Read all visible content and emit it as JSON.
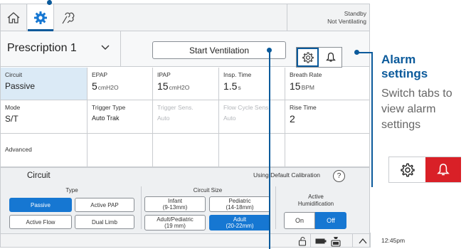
{
  "status": {
    "line1": "Standby",
    "line2": "Not Ventilating"
  },
  "prescription": {
    "name": "Prescription 1",
    "start_label": "Start Ventilation"
  },
  "grid": {
    "circuit": {
      "label": "Circuit",
      "value": "Passive"
    },
    "mode": {
      "label": "Mode",
      "value": "S/T"
    },
    "advanced": {
      "label": "Advanced"
    },
    "epap": {
      "label": "EPAP",
      "value": "5",
      "unit": "cmH2O"
    },
    "ipap": {
      "label": "IPAP",
      "value": "15",
      "unit": "cmH2O"
    },
    "insp_time": {
      "label": "Insp. Time",
      "value": "1.5",
      "unit": "s"
    },
    "breath_rate": {
      "label": "Breath Rate",
      "value": "15",
      "unit": "BPM"
    },
    "trigger_type": {
      "label": "Trigger Type",
      "value": "Auto Trak"
    },
    "trigger_sens": {
      "label": "Trigger Sens.",
      "value": "Auto"
    },
    "flow_cycle": {
      "label": "Flow Cycle Sens.",
      "value": "Auto"
    },
    "rise_time": {
      "label": "Rise Time",
      "value": "2"
    }
  },
  "circuit_panel": {
    "title": "Circuit",
    "calibration": "Using Default Calibration",
    "help": "?",
    "type_label": "Type",
    "types": [
      "Passive",
      "Active PAP",
      "Active Flow",
      "Dual Limb"
    ],
    "size_label": "Circuit Size",
    "sizes": [
      "Infant\n(9-13mm)",
      "Pediatric\n(14-18mm)",
      "Adult/Pediatric\n(19 mm)",
      "Adult\n(20-22mm)"
    ],
    "humid_label": "Active\nHumidification",
    "humid_on": "On",
    "humid_off": "Off"
  },
  "bottom": {
    "time": "12:45pm"
  },
  "annotation": {
    "title": "Alarm settings",
    "description": "Switch tabs to view alarm settings"
  },
  "colors": {
    "accent": "#0b5a9b",
    "selected": "#1677d2",
    "alarm": "#d92027"
  }
}
